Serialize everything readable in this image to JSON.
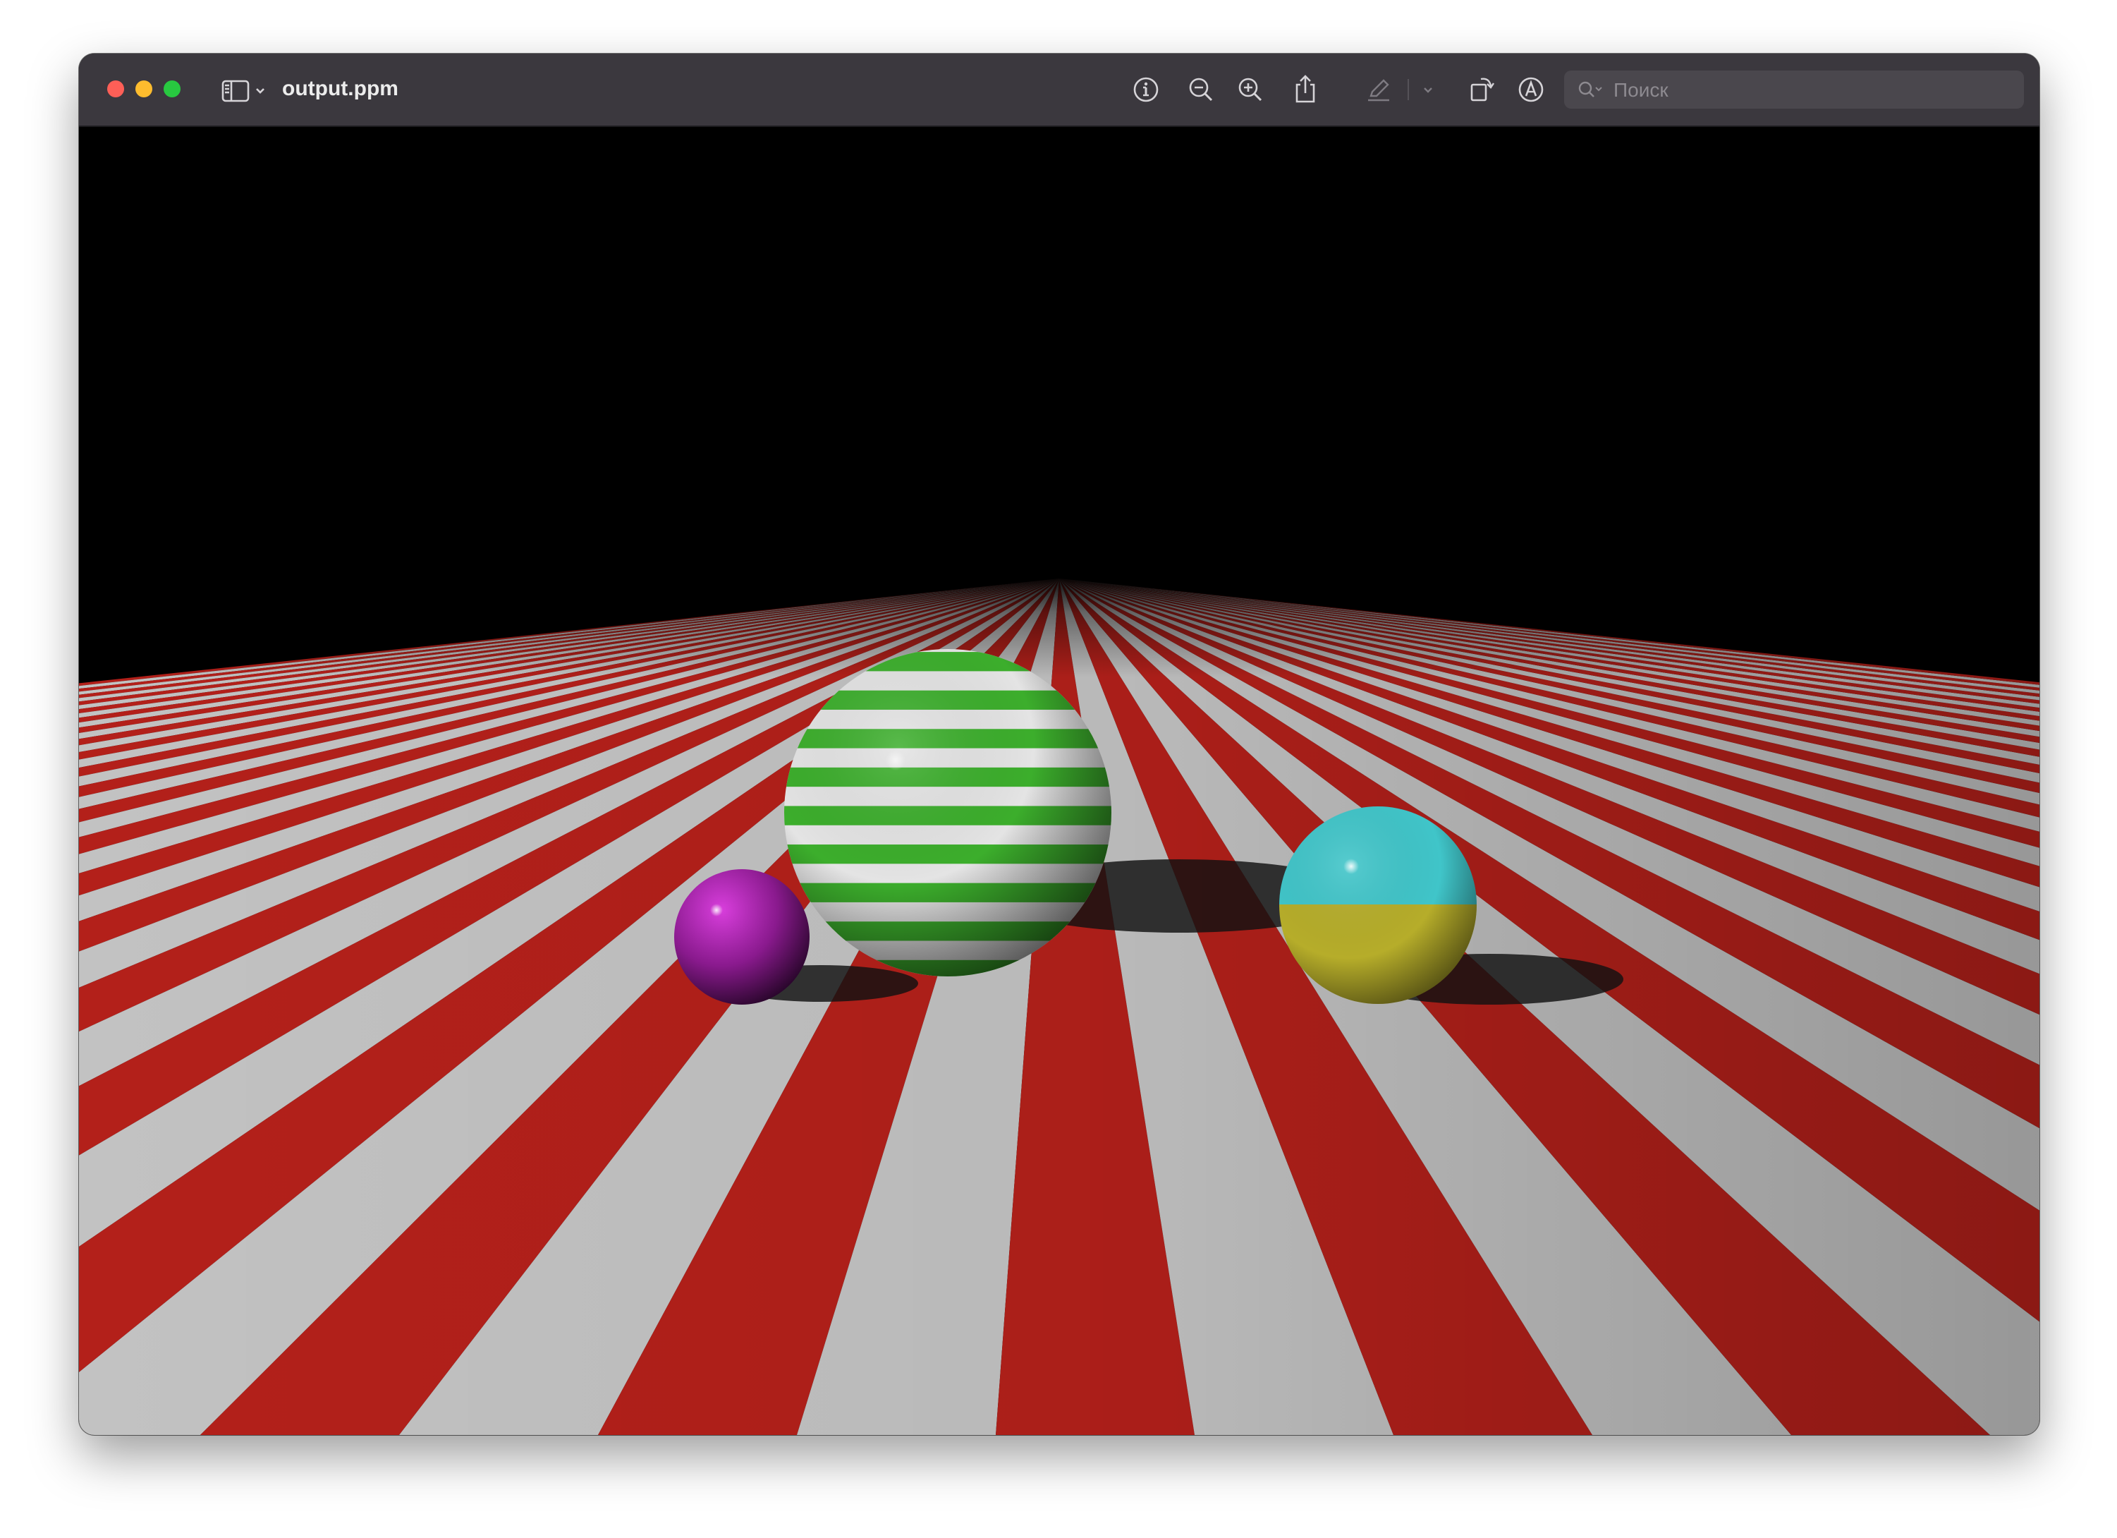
{
  "window": {
    "title": "output.ppm"
  },
  "toolbar": {
    "buttons": [
      {
        "name": "info-button",
        "icon": "info-circle-icon"
      },
      {
        "name": "zoom-out-button",
        "icon": "zoom-out-icon"
      },
      {
        "name": "zoom-in-button",
        "icon": "zoom-in-icon"
      },
      {
        "name": "share-button",
        "icon": "share-icon"
      },
      {
        "name": "markup-button",
        "icon": "pencil-icon"
      },
      {
        "name": "markup-menu-button",
        "icon": "chevron-down-icon"
      },
      {
        "name": "rotate-button",
        "icon": "rotate-icon"
      },
      {
        "name": "annotate-button",
        "icon": "annotate-circle-icon"
      }
    ],
    "search_placeholder": "Поиск",
    "search_value": ""
  },
  "image": {
    "background": "#000000",
    "floor_colors": [
      "#b3201a",
      "#c2c2c2"
    ],
    "spheres": [
      {
        "name": "magenta-sphere",
        "color": "#a21ea6"
      },
      {
        "name": "striped-green-sphere",
        "colors": [
          "#3cae2c",
          "#e8e8e8"
        ]
      },
      {
        "name": "cyan-yellow-sphere",
        "colors": [
          "#3fc4c8",
          "#b8b02a"
        ]
      }
    ]
  },
  "colors": {
    "titlebar": "#3b383e",
    "traffic_close": "#fe5f57",
    "traffic_minimize": "#febc2e",
    "traffic_maximize": "#28c840"
  }
}
